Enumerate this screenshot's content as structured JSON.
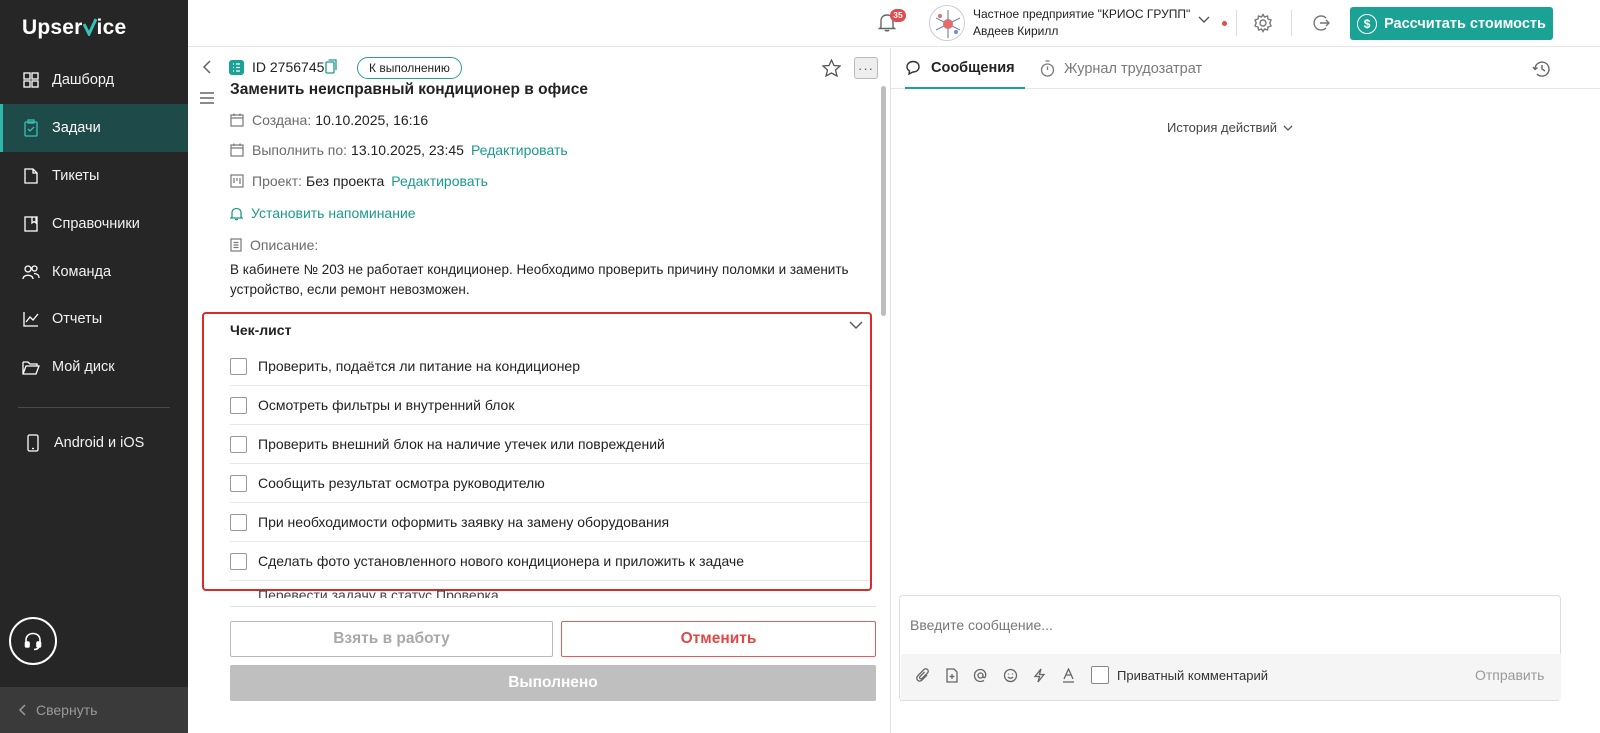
{
  "app": {
    "logo_pre": "Upser",
    "logo_accent": "V",
    "logo_post": "ice",
    "accent_color": "#1aa394"
  },
  "sidebar": {
    "items": [
      {
        "label": "Дашборд",
        "icon": "dashboard-icon"
      },
      {
        "label": "Задачи",
        "icon": "tasks-icon",
        "active": true
      },
      {
        "label": "Тикеты",
        "icon": "tickets-icon"
      },
      {
        "label": "Справочники",
        "icon": "book-icon"
      },
      {
        "label": "Команда",
        "icon": "team-icon"
      },
      {
        "label": "Отчеты",
        "icon": "chart-icon"
      },
      {
        "label": "Мой диск",
        "icon": "folder-icon"
      }
    ],
    "mobile_label": "Android и iOS",
    "collapse_label": "Свернуть"
  },
  "topbar": {
    "notifications_count": "35",
    "company_name": "Частное предприятие \"КРИОС ГРУПП\"",
    "user_name": "Авдеев Кирилл",
    "calc_button": "Рассчитать стоимость"
  },
  "task": {
    "id": "ID 2756745",
    "status": "К выполнению",
    "title": "Заменить неисправный кондиционер в офисе",
    "created_label": "Создана:",
    "created_value": "10.10.2025, 16:16",
    "due_label": "Выполнить по:",
    "due_value": "13.10.2025, 23:45",
    "edit_label": "Редактировать",
    "project_label": "Проект:",
    "project_value": "Без проекта",
    "reminder_label": "Установить напоминание",
    "description_label": "Описание:",
    "description": "В кабинете № 203 не работает кондиционер. Необходимо проверить причину поломки и заменить устройство, если ремонт невозможен."
  },
  "checklist": {
    "title": "Чек-лист",
    "items": [
      "Проверить, подаётся ли питание на кондиционер",
      "Осмотреть фильтры и внутренний блок",
      "Проверить внешний блок на наличие утечек или повреждений",
      "Сообщить результат осмотра руководителю",
      "При необходимости оформить заявку на замену оборудования",
      "Сделать фото установленного нового кондиционера и приложить к задаче"
    ],
    "partial_item": "Перевести задачу в статус Проверка"
  },
  "actions": {
    "take": "Взять в работу",
    "cancel": "Отменить",
    "done": "Выполнено"
  },
  "right_panel": {
    "tab_messages": "Сообщения",
    "tab_journal": "Журнал трудозатрат",
    "history_actions": "История действий",
    "message_placeholder": "Введите сообщение...",
    "private_comment": "Приватный комментарий",
    "send": "Отправить"
  }
}
